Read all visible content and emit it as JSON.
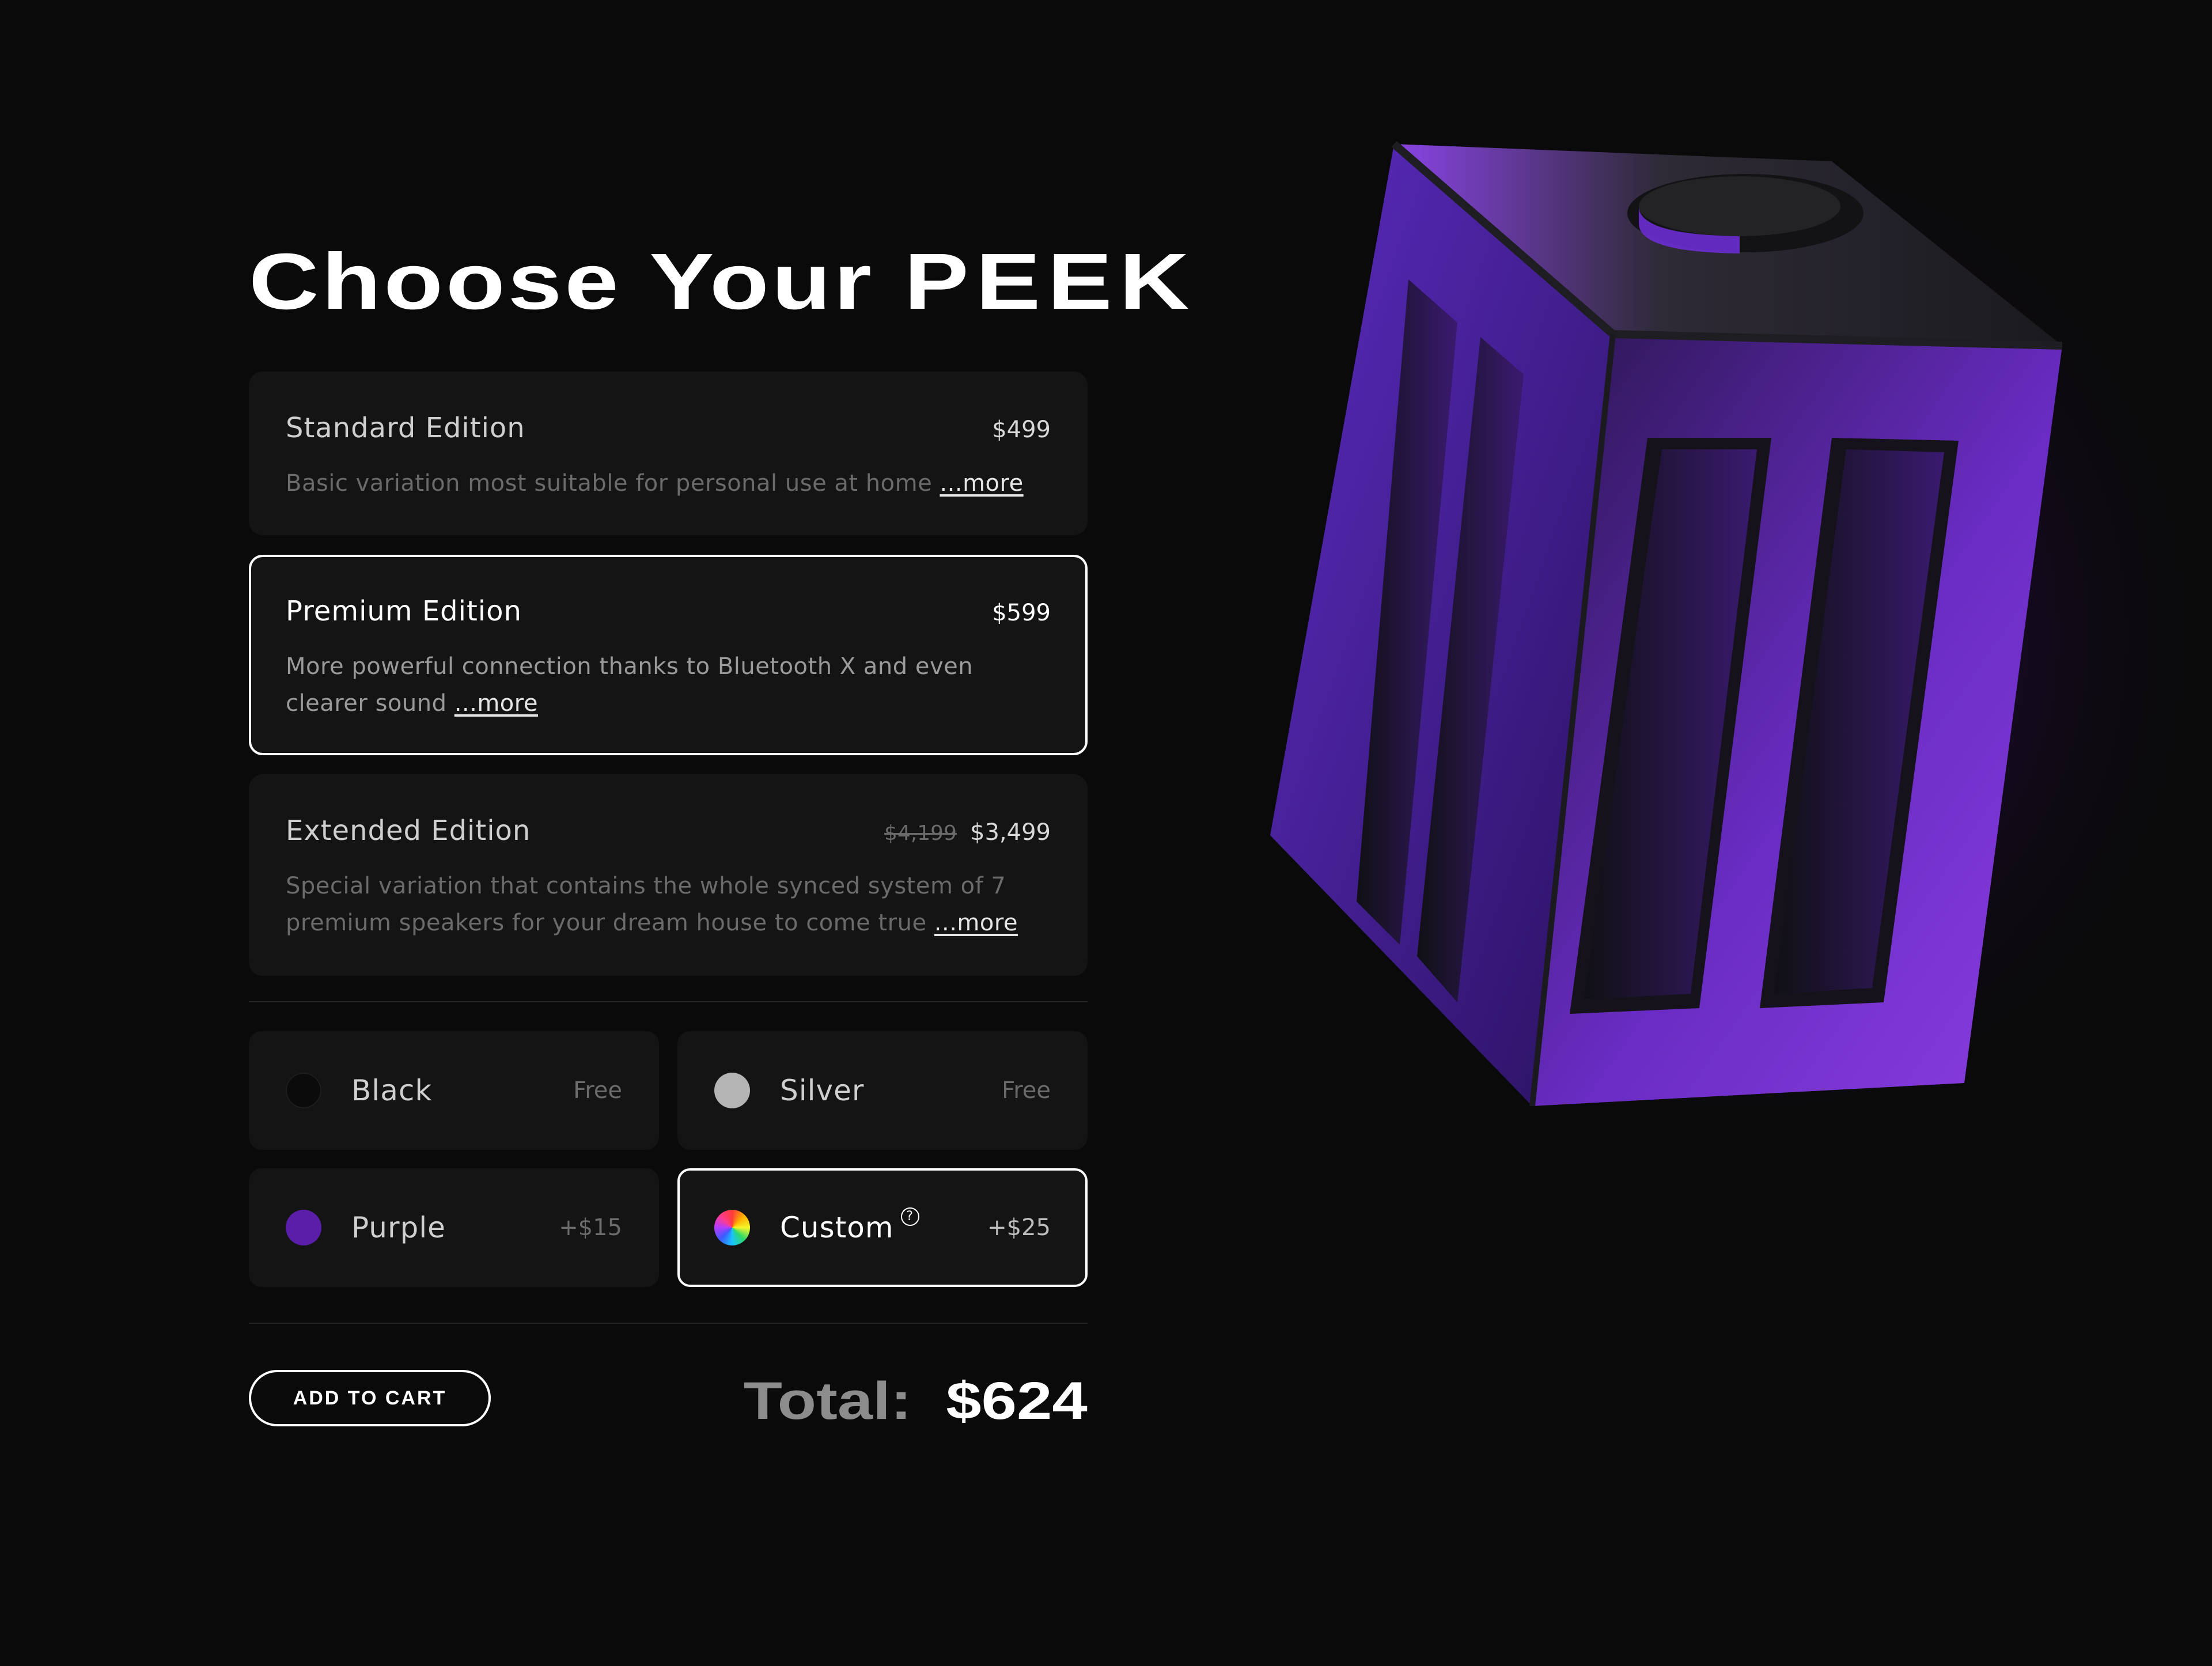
{
  "title": {
    "prefix": "Choose Your",
    "brand": "PEEK"
  },
  "editions": [
    {
      "name": "Standard Edition",
      "price": "$499",
      "old_price": "",
      "description": "Basic variation most suitable for personal use at home",
      "more_label": "...more",
      "selected": false
    },
    {
      "name": "Premium Edition",
      "price": "$599",
      "old_price": "",
      "description": "More powerful connection thanks to Bluetooth X and even clearer sound",
      "more_label": "...more",
      "selected": true
    },
    {
      "name": "Extended Edition",
      "price": "$3,499",
      "old_price": "$4,199",
      "description": "Special variation that contains the whole synced system of 7 premium speakers for your dream house to come true",
      "more_label": "...more",
      "selected": false
    }
  ],
  "colors": [
    {
      "name": "Black",
      "price": "Free",
      "swatch": "#0b0b0b",
      "selected": false
    },
    {
      "name": "Silver",
      "price": "Free",
      "swatch": "#b4b4b4",
      "selected": false
    },
    {
      "name": "Purple",
      "price": "+$15",
      "swatch": "#5a1ea8",
      "selected": false
    },
    {
      "name": "Custom",
      "price": "+$25",
      "swatch": "rainbow",
      "selected": true,
      "help_icon": "?"
    }
  ],
  "cart": {
    "button_label": "ADD TO CART"
  },
  "total": {
    "label": "Total:",
    "value": "$624"
  },
  "theme": {
    "background": "#0a0a0a",
    "card": "#141414",
    "accent": "#7b2ff0"
  },
  "icons": {
    "help": "question-circle-icon",
    "product": "speaker-cube-illustration"
  }
}
